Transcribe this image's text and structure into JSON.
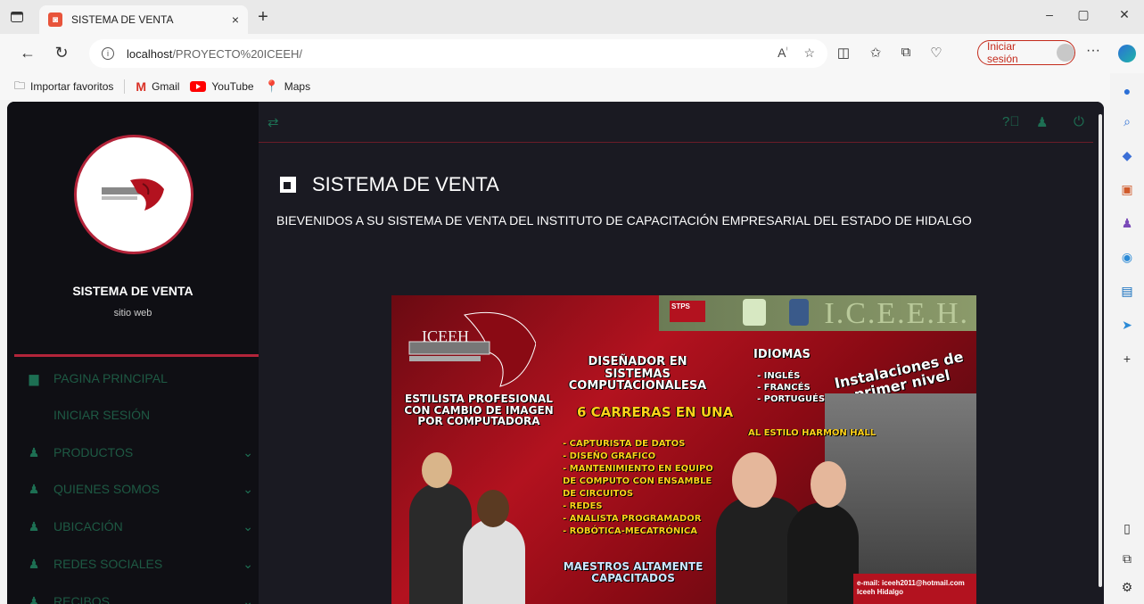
{
  "browser": {
    "tab_title": "SISTEMA DE VENTA",
    "tab_close": "×",
    "new_tab": "+",
    "url_host": "localhost",
    "url_path": "/PROYECTO%20ICEEH/",
    "signin_label": "Iniciar sesión",
    "more": "···",
    "win_minimize": "–",
    "win_restore": "▢",
    "win_close": "✕"
  },
  "bookmarks": {
    "import": "Importar favoritos",
    "gmail": "Gmail",
    "youtube": "YouTube",
    "maps": "Maps"
  },
  "sidebar": {
    "site_name": "SISTEMA DE VENTA",
    "site_sub": "sitio web",
    "items": [
      {
        "label": "PAGINA PRINCIPAL",
        "icon": "square-icon",
        "chevron": false
      },
      {
        "label": "INICIAR SESIÓN",
        "icon": "",
        "chevron": false
      },
      {
        "label": "PRODUCTOS",
        "icon": "users-icon",
        "chevron": true
      },
      {
        "label": "QUIENES SOMOS",
        "icon": "users-icon",
        "chevron": true
      },
      {
        "label": "UBICACIÓN",
        "icon": "users-icon",
        "chevron": true
      },
      {
        "label": "REDES SOCIALES",
        "icon": "users-icon",
        "chevron": true
      },
      {
        "label": "RECIBOS",
        "icon": "users-icon",
        "chevron": true
      }
    ]
  },
  "main": {
    "title": "SISTEMA DE VENTA",
    "welcome": "BIEVENIDOS A SU SISTEMA DE VENTA DEL INSTITUTO DE CAPACITACIÓN EMPRESARIAL DEL ESTADO DE HIDALGO"
  },
  "banner": {
    "header_brand": "I.C.E.E.H.",
    "stps": "STPS",
    "logo_text": "ICEEH",
    "disenador": "DISEÑADOR EN SISTEMAS COMPUTACIONALESA",
    "idiomas": "IDIOMAS",
    "idiomas_list": [
      "- INGLÉS",
      "- FRANCÉS",
      "- PORTUGUÉS"
    ],
    "instalaciones": "Instalaciones de primer nivel",
    "estilista": "ESTILISTA PROFESIONAL CON CAMBIO DE IMAGEN POR COMPUTADORA",
    "carreras": "6 CARRERAS EN UNA",
    "harmon": "AL ESTILO HARMON HALL",
    "lista": [
      "- CAPTURISTA DE DATOS",
      "- DISEÑO GRAFICO",
      "- MANTENIMIENTO EN EQUIPO",
      "DE COMPUTO CON ENSAMBLE",
      "DE CIRCUITOS",
      "- REDES",
      "- ANALISTA PROGRAMADOR",
      "- ROBÓTICA-MECATRÓNICA"
    ],
    "maestros": "MAESTROS ALTAMENTE CAPACITADOS",
    "email": "e-mail: iceeh2011@hotmail.com",
    "facebook": "Iceeh Hidalgo"
  }
}
